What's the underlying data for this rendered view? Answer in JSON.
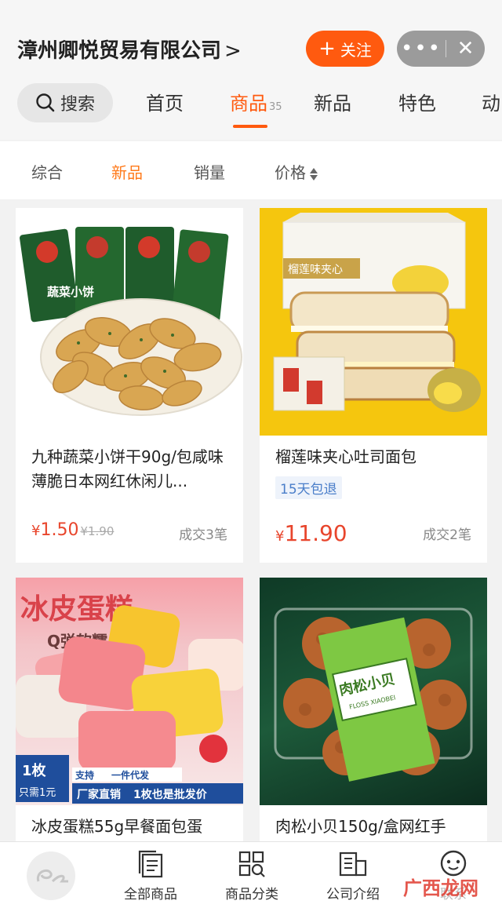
{
  "header": {
    "company_name": "漳州卿悦贸易有限公司",
    "company_chevron": ">",
    "follow_label": "关注",
    "follow_plus": "+",
    "more_dots": "•••",
    "close_glyph": "✕"
  },
  "nav": {
    "search_label": "搜索",
    "tabs": [
      {
        "label": "首页"
      },
      {
        "label": "商品",
        "count": "35"
      },
      {
        "label": "新品"
      },
      {
        "label": "特色"
      },
      {
        "label": "动"
      }
    ]
  },
  "filter": {
    "items": [
      "综合",
      "新品",
      "销量",
      "价格"
    ]
  },
  "products": [
    {
      "title": "九种蔬菜小饼干90g/包咸味薄脆日本网红休闲儿...",
      "currency": "¥",
      "price": "1.50",
      "old_price": "¥1.90",
      "sold": "成交3笔",
      "image_texts": [
        "蔬菜小饼"
      ]
    },
    {
      "title": "榴莲味夹心吐司面包",
      "badge": "15天包退",
      "currency": "¥",
      "price": "11.90",
      "sold": "成交2笔",
      "image_texts": [
        "榴莲味夹心"
      ]
    },
    {
      "title": "冰皮蛋糕55g早餐面包蛋",
      "image_texts": [
        "冰皮蛋糕",
        "Q弹软糯",
        "1枚",
        "只需1元",
        "支持",
        "一件代发",
        "厂家直销",
        "1枚也是批发价"
      ]
    },
    {
      "title": "肉松小贝150g/盒网红手",
      "image_texts": [
        "肉松小贝",
        "FLOSS XIAOBEI"
      ]
    }
  ],
  "bottom_bar": {
    "items": [
      {
        "label": "全部商品",
        "icon": "document-list-icon"
      },
      {
        "label": "商品分类",
        "icon": "category-grid-icon"
      },
      {
        "label": "公司介绍",
        "icon": "building-icon"
      },
      {
        "label": "联系",
        "icon": "chat-icon"
      }
    ],
    "watermark": "广西龙网"
  },
  "colors": {
    "accent": "#ff5a0f",
    "price": "#e8452c",
    "badge": "#4a7ec9"
  }
}
